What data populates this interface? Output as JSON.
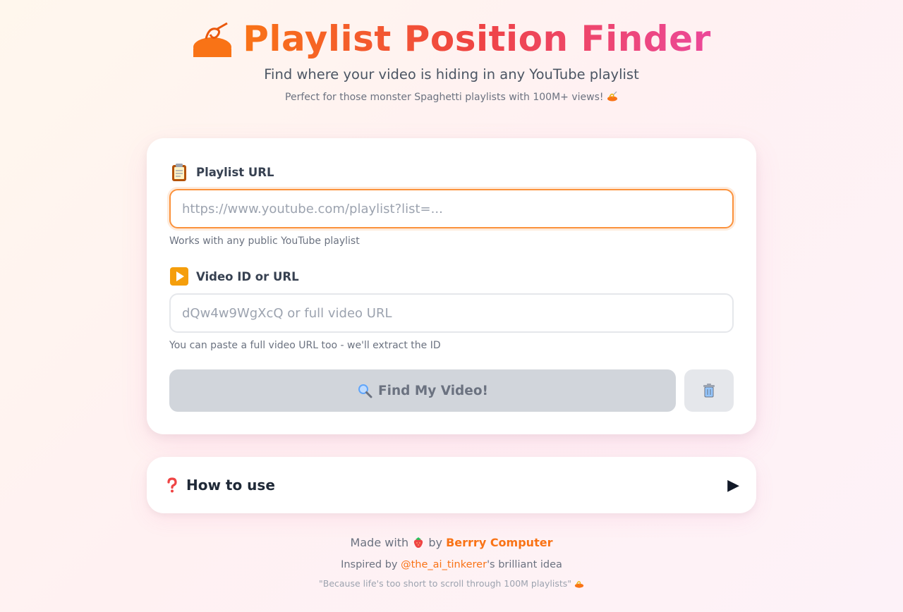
{
  "header": {
    "logo_icon": "spaghetti-bowl-icon",
    "title": "Playlist Position Finder",
    "subtitle": "Find where your video is hiding in any YouTube playlist",
    "tagline": "Perfect for those monster Spaghetti playlists with 100M+ views!",
    "tagline_icon": "spaghetti-icon"
  },
  "form": {
    "playlist": {
      "icon": "clipboard-icon",
      "label": "Playlist URL",
      "placeholder": "https://www.youtube.com/playlist?list=...",
      "value": "",
      "hint": "Works with any public YouTube playlist"
    },
    "video": {
      "icon": "play-button-icon",
      "label": "Video ID or URL",
      "placeholder": "dQw4w9WgXcQ or full video URL",
      "value": "",
      "hint": "You can paste a full video URL too - we'll extract the ID"
    },
    "find_button": {
      "icon": "magnifier-icon",
      "label": "Find My Video!"
    },
    "clear_button": {
      "icon": "trash-icon"
    }
  },
  "howto": {
    "icon": "question-mark-icon",
    "title": "How to use",
    "arrow": "▶"
  },
  "footer": {
    "made_with_prefix": "Made with",
    "made_with_icon": "strawberry-icon",
    "by": "by",
    "brand": "Berrry Computer",
    "inspired_prefix": "Inspired by",
    "inspired_handle": "@the_ai_tinkerer",
    "inspired_suffix": "'s brilliant idea",
    "quote": "\"Because life's too short to scroll through 100M playlists\"",
    "quote_icon": "spaghetti-icon"
  },
  "colors": {
    "accent": "#f97316",
    "title_gradient_start": "#f97316",
    "title_gradient_mid": "#ef4444",
    "title_gradient_end": "#ec4899",
    "focus_border": "#fb923c",
    "disabled_button": "#d1d5db"
  }
}
